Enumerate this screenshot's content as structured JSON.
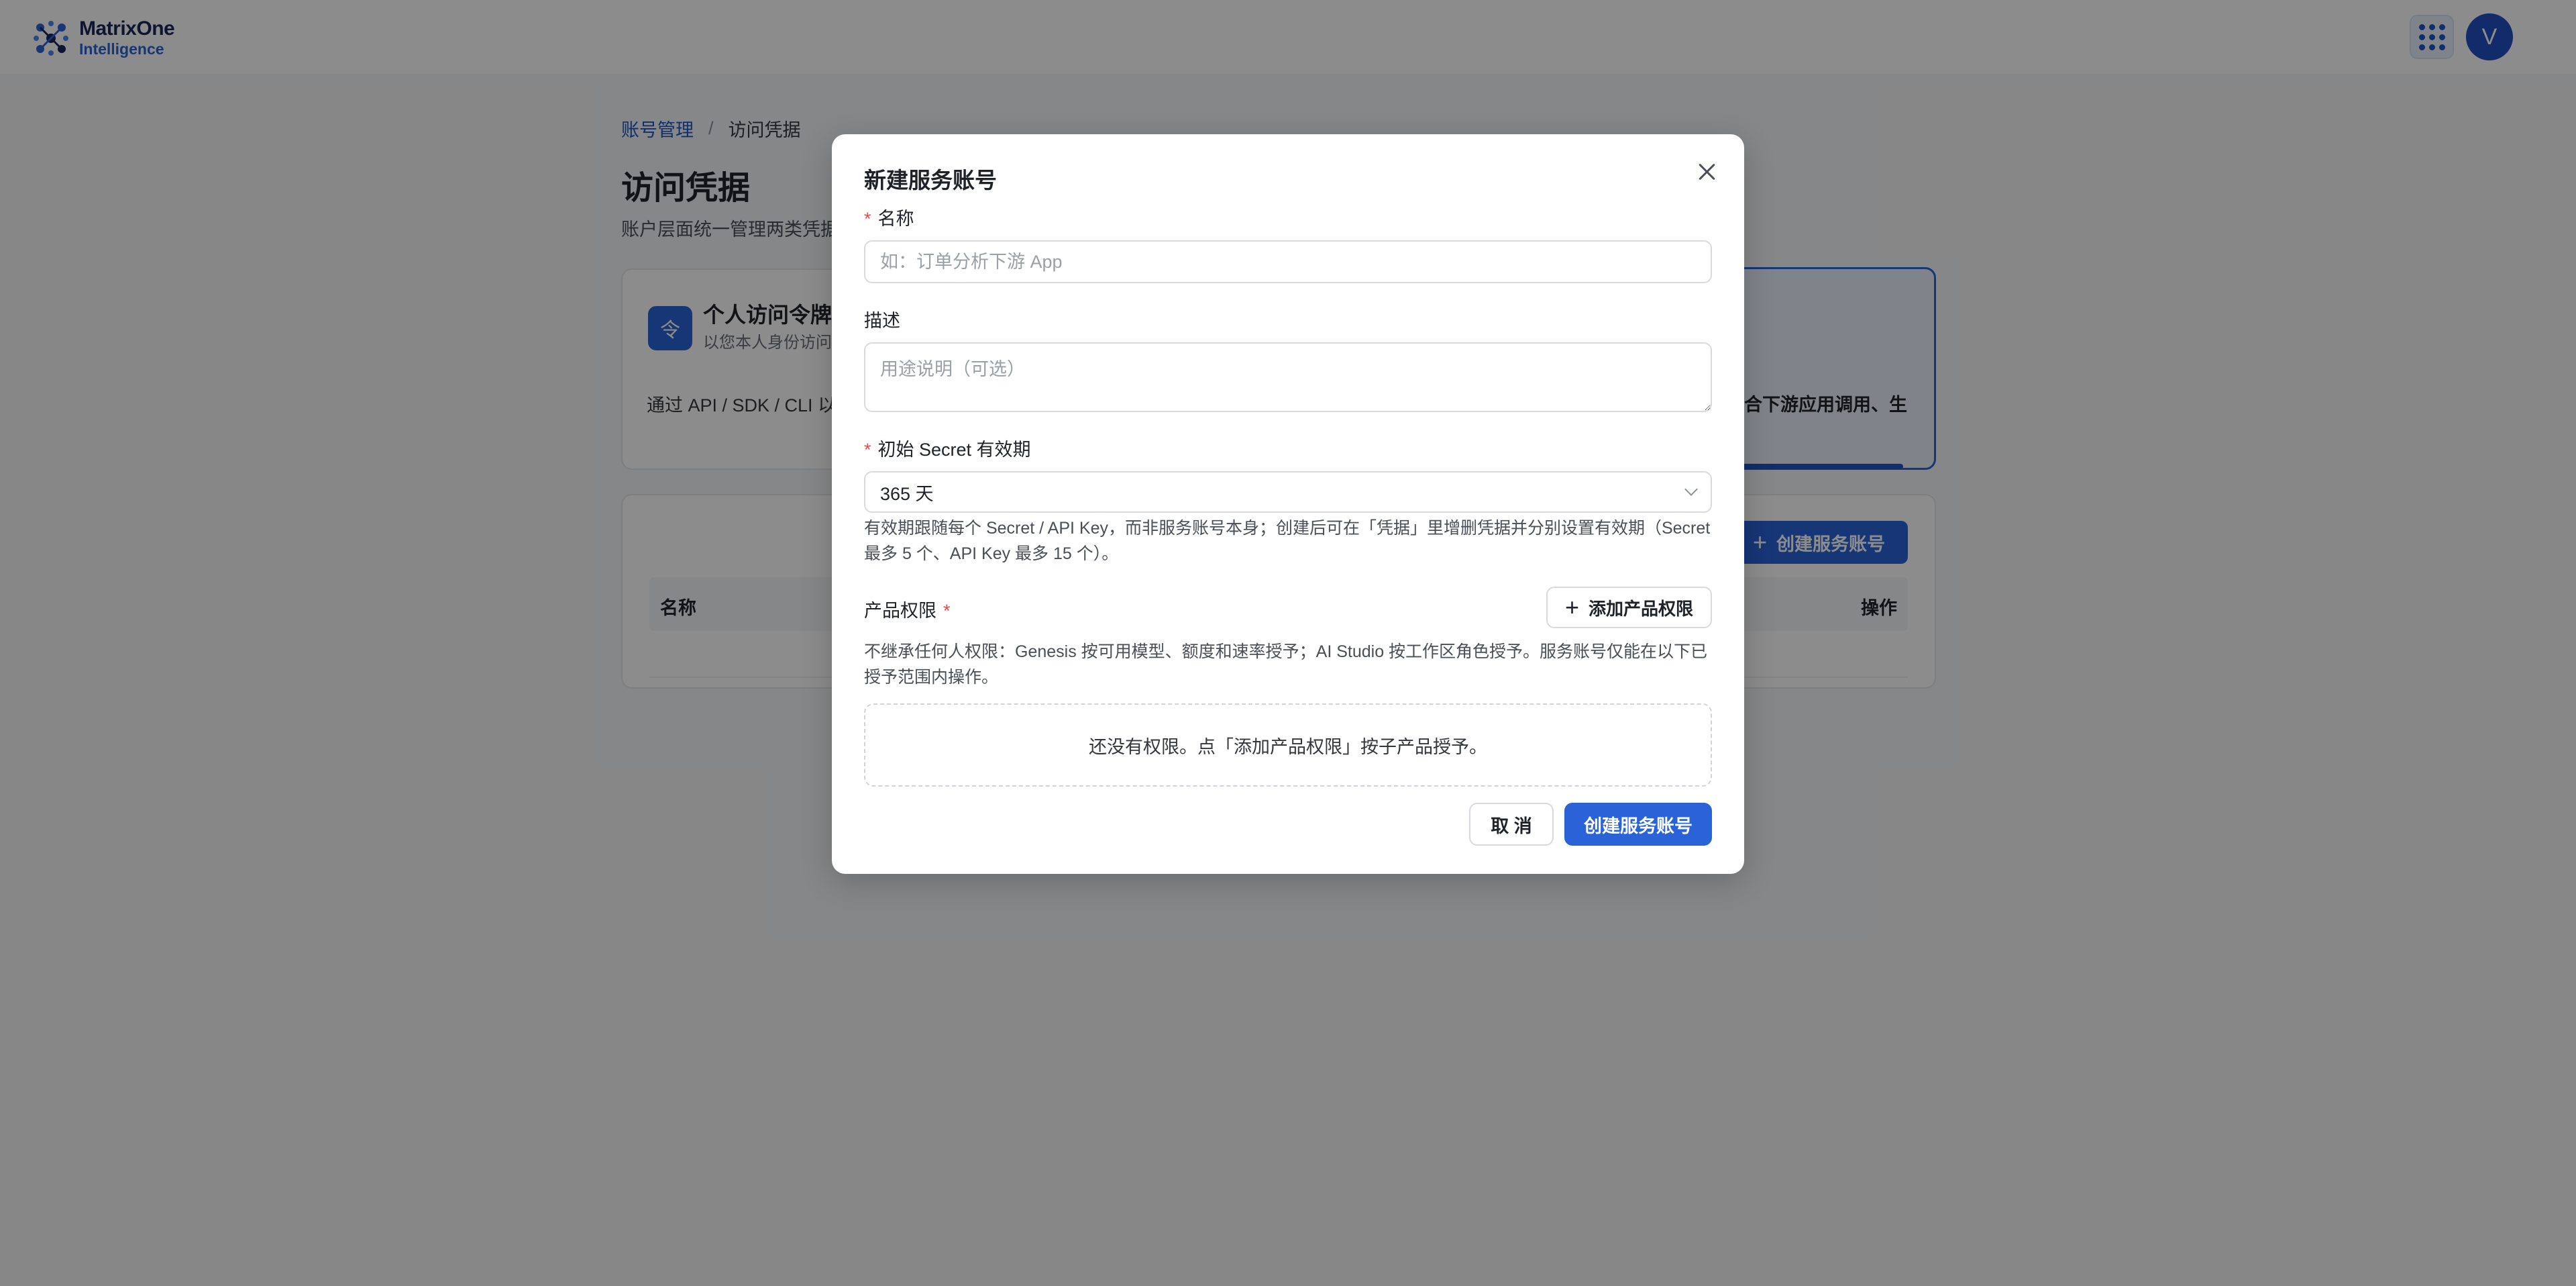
{
  "brand": {
    "name": "MatrixOne",
    "sub": "Intelligence",
    "apps_icon": "grid-icon",
    "avatar_initial": "V",
    "accent_color": "#2a63d8"
  },
  "breadcrumb": {
    "parent": "账号管理",
    "separator": "/",
    "current": "访问凭据"
  },
  "page": {
    "title": "访问凭据",
    "subtitle": "账户层面统一管理两类凭据"
  },
  "cards": {
    "pat": {
      "icon_char": "令",
      "title": "个人访问令牌",
      "subtitle": "以您本人身份访问",
      "desc": "通过 API / SDK / CLI 以发、脚本、BI 直连等个人"
    },
    "service_account": {
      "desc": "适合下游应用调用、生"
    }
  },
  "list": {
    "create_button": "创建服务账号",
    "col_name": "名称",
    "col_actions": "操作"
  },
  "modal": {
    "title": "新建服务账号",
    "close_icon": "close-icon",
    "name_label": "名称",
    "name_placeholder": "如：订单分析下游 App",
    "desc_label": "描述",
    "desc_placeholder": "用途说明（可选）",
    "secret_label": "初始 Secret 有效期",
    "secret_value": "365 天",
    "secret_hint": "有效期跟随每个 Secret / API Key，而非服务账号本身；创建后可在「凭据」里增删凭据并分别设置有效期（Secret 最多 5 个、API Key 最多 15 个）。",
    "perm_label": "产品权限",
    "add_perm_button": "添加产品权限",
    "perm_hint": "不继承任何人权限：Genesis 按可用模型、额度和速率授予；AI Studio 按工作区角色授予。服务账号仅能在以下已授予范围内操作。",
    "empty_text": "还没有权限。点「添加产品权限」按子产品授予。",
    "cancel_button": "取 消",
    "submit_button": "创建服务账号"
  }
}
